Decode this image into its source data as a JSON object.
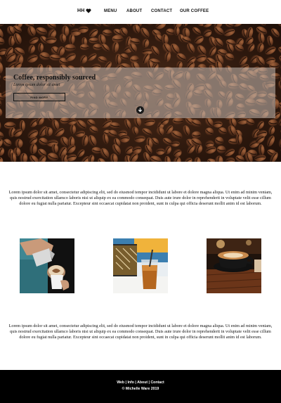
{
  "nav": {
    "logo_text": "HH",
    "logo_icon": "heart-icon",
    "items": [
      {
        "label": "MENU"
      },
      {
        "label": "ABOUT"
      },
      {
        "label": "CONTACT"
      },
      {
        "label": "OUR COFFEE"
      }
    ]
  },
  "hero": {
    "title": "Coffee, responsibly sourced",
    "subtitle": "Lorem ipsum dolor sit amet",
    "button_label": "FIND MORE",
    "scroll_icon": "arrow-down-circle-icon"
  },
  "intro": {
    "text": "Lorem ipsum dolor sit amet, consectetur adipiscing elit, sed do eiusmod tempor incididunt ut labore et dolore magna aliqua. Ut enim ad minim veniam, quis nostrud exercitation ullamco laboris nisi ut aliquip ex ea commodo consequat. Duis aute irure dolor in reprehenderit in voluptate velit esse cillum dolore eu fugiat nulla pariatur. Excepteur sint occaecat cupidatat non proident, sunt in culpa qui officia deserunt mollit anim id est laborum."
  },
  "gallery": [
    {
      "name": "latte-art-pour-photo"
    },
    {
      "name": "iced-coffee-photo"
    },
    {
      "name": "cappuccino-cup-photo"
    }
  ],
  "outro": {
    "text": "Lorem ipsum dolor sit amet, consectetur adipiscing elit, sed do eiusmod tempor incididunt ut labore et dolore magna aliqua. Ut enim ad minim veniam, quis nostrud exercitation ullamco laboris nisi ut aliquip ex ea commodo consequat. Duis aute irure dolor in reprehenderit in voluptate velit esse cillum dolore eu fugiat nulla pariatur. Excepteur sint occaecat cupidatat non proident, sunt in culpa qui officia deserunt mollit anim id est laborum."
  },
  "footer": {
    "links": [
      {
        "label": "Web"
      },
      {
        "label": "Info"
      },
      {
        "label": "About"
      },
      {
        "label": "Contact"
      }
    ],
    "separator": " | ",
    "copyright": "© Michelle Ware 2019"
  },
  "colors": {
    "footer_bg": "#000000",
    "hero_overlay": "#c8beb6",
    "bean_dark": "#2a160d",
    "bean_mid": "#6b3c22"
  }
}
